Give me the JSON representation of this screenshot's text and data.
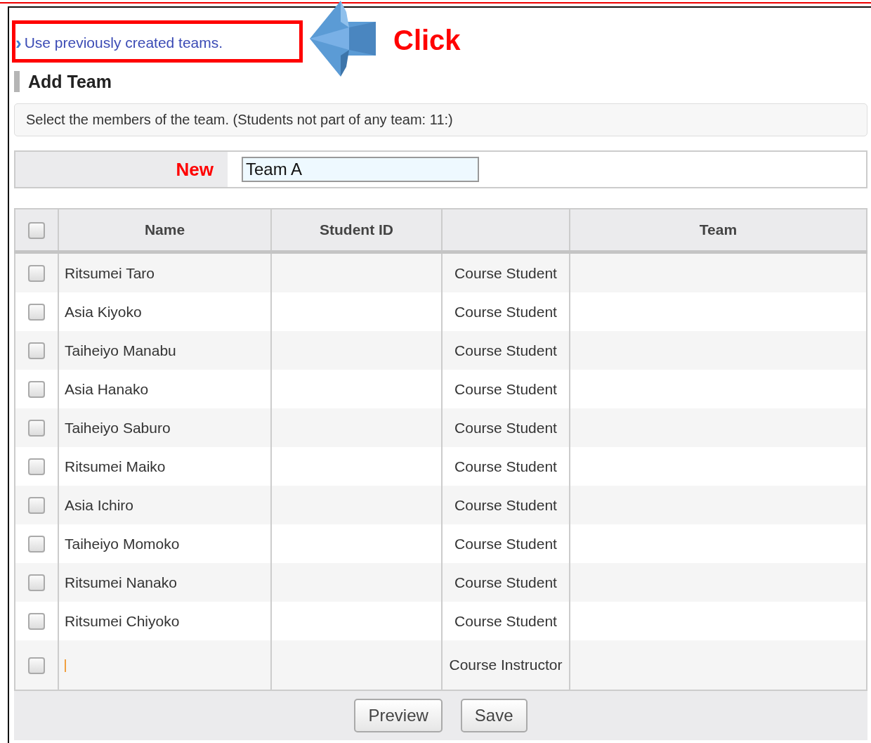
{
  "annotation": {
    "callout": "Click"
  },
  "link": {
    "icon": "›",
    "label": "Use previously created teams."
  },
  "heading": "Add Team",
  "info": "Select the members of the team. (Students not part of any team: 11:)",
  "new_team": {
    "label": "New",
    "value": "Team A"
  },
  "table": {
    "select_all_checked": false,
    "columns": [
      "Name",
      "Student ID",
      "",
      "Team"
    ],
    "rows": [
      {
        "checked": false,
        "name": "Ritsumei Taro",
        "role": "Course Student"
      },
      {
        "checked": false,
        "name": "Asia Kiyoko",
        "role": "Course Student"
      },
      {
        "checked": false,
        "name": "Taiheiyo Manabu",
        "role": "Course Student"
      },
      {
        "checked": false,
        "name": "Asia Hanako",
        "role": "Course Student"
      },
      {
        "checked": false,
        "name": "Taiheiyo Saburo",
        "role": "Course Student"
      },
      {
        "checked": false,
        "name": "Ritsumei Maiko",
        "role": "Course Student"
      },
      {
        "checked": false,
        "name": "Asia Ichiro",
        "role": "Course Student"
      },
      {
        "checked": false,
        "name": "Taiheiyo Momoko",
        "role": "Course Student"
      },
      {
        "checked": false,
        "name": "Ritsumei Nanako",
        "role": "Course Student"
      },
      {
        "checked": false,
        "name": "Ritsumei Chiyoko",
        "role": "Course Student"
      },
      {
        "checked": false,
        "name": "",
        "role": "Course Instructor",
        "kind": "instructor"
      }
    ]
  },
  "buttons": [
    "Preview",
    "Save"
  ]
}
